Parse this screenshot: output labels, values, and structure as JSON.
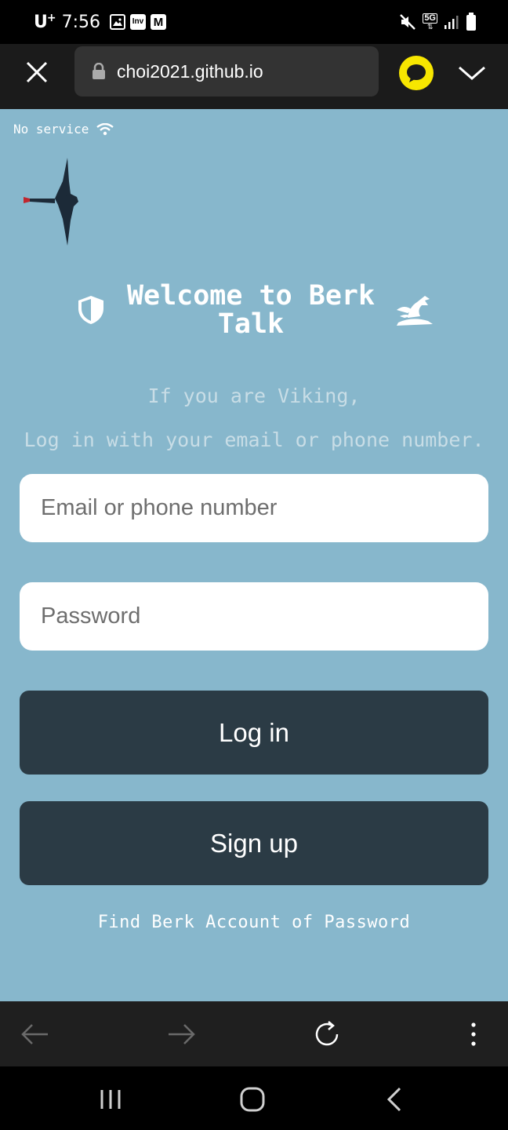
{
  "status_bar": {
    "carrier": "U",
    "carrier_sup": "+",
    "time": "7:56",
    "notifications": [
      "image-icon",
      "inv-icon",
      "gmail-icon"
    ],
    "notification_labels": {
      "inv": "Inv",
      "gmail": "M"
    },
    "network_label": "5G"
  },
  "toolbar": {
    "url": "choi2021.github.io",
    "kakao_color": "#f7e600"
  },
  "page": {
    "no_service": "No service",
    "title": "Welcome to Berk Talk",
    "subtitle_line1": "If you are Viking,",
    "subtitle_line2": "Log in with your email or phone number.",
    "email_placeholder": "Email or phone number",
    "email_value": "",
    "password_placeholder": "Password",
    "password_value": "",
    "login_label": "Log in",
    "signup_label": "Sign up",
    "find_link": "Find Berk Account of Password",
    "background_color": "#87b7cc",
    "button_color": "#2b3b45"
  },
  "browser_nav": [
    "back-icon",
    "forward-icon",
    "reload-icon",
    "more-icon"
  ],
  "system_nav": [
    "recents-icon",
    "home-icon",
    "back-icon"
  ]
}
